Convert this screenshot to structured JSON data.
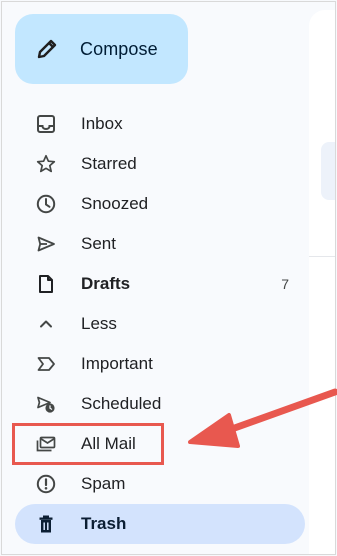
{
  "compose": {
    "label": "Compose",
    "icon": "pencil-icon"
  },
  "nav": {
    "items": [
      {
        "label": "Inbox",
        "icon": "inbox-icon"
      },
      {
        "label": "Starred",
        "icon": "star-icon"
      },
      {
        "label": "Snoozed",
        "icon": "clock-icon"
      },
      {
        "label": "Sent",
        "icon": "send-icon"
      },
      {
        "label": "Drafts",
        "icon": "draft-icon",
        "count": "7"
      },
      {
        "label": "Less",
        "icon": "chevron-up-icon"
      },
      {
        "label": "Important",
        "icon": "important-icon"
      },
      {
        "label": "Scheduled",
        "icon": "scheduled-icon"
      },
      {
        "label": "All Mail",
        "icon": "all-mail-icon"
      },
      {
        "label": "Spam",
        "icon": "spam-icon"
      },
      {
        "label": "Trash",
        "icon": "trash-icon"
      }
    ]
  },
  "colors": {
    "compose_bg": "#c2e7ff",
    "active_bg": "#d3e3fd",
    "annotation": "#e8584f"
  }
}
